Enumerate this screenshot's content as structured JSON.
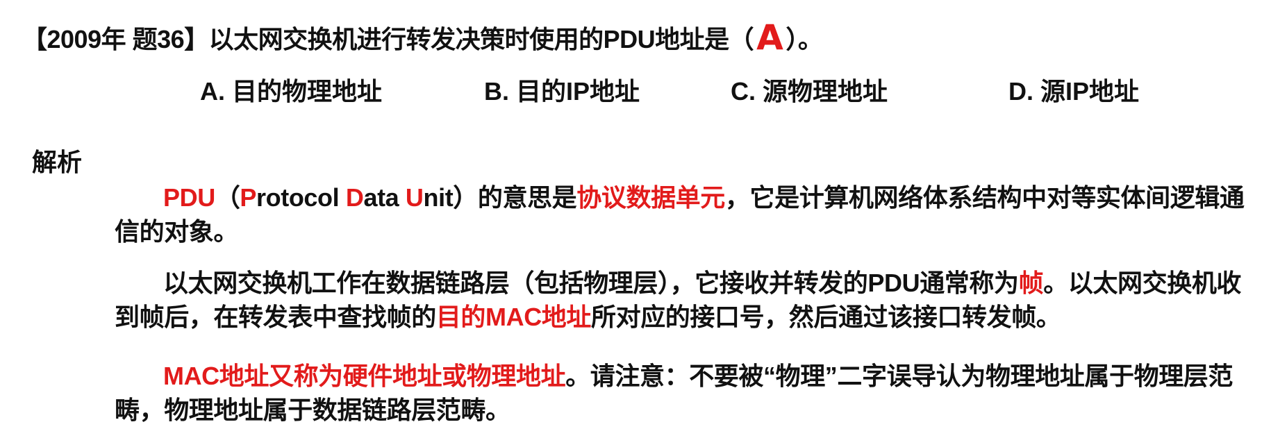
{
  "question": {
    "prefix": "【2009年 题36】以太网交换机进行转发决策时使用的PDU地址是（",
    "answer": "A",
    "suffix": "）。"
  },
  "options": [
    {
      "label": "A. 目的物理地址"
    },
    {
      "label": "B. 目的IP地址"
    },
    {
      "label": "C. 源物理地址"
    },
    {
      "label": "D. 源IP地址"
    }
  ],
  "analysis": {
    "title": "解析",
    "p1": {
      "t1": "PDU",
      "t2": "（",
      "t3": "P",
      "t4": "rotocol ",
      "t5": "D",
      "t6": "ata ",
      "t7": "U",
      "t8": "nit）的意思是",
      "t9": "协议数据单元",
      "t10": "，它是计算机网络体系结构中对等实体间逻辑通信的对象。"
    },
    "p2": {
      "t1": "以太网交换机工作在数据链路层（包括物理层），它接收并转发的PDU通常称为",
      "t2": "帧",
      "t3": "。以太网交换机收到帧后，在转发表中查找帧的",
      "t4": "目的MAC地址",
      "t5": "所对应的接口号，然后通过该接口转发帧。"
    },
    "p3": {
      "t1": "MAC地址又称为硬件地址或物理地址",
      "t2": "。请注意：不要被“物理”二字误导认为物理地址属于物理层范畴，物理地址属于数据链路层范畴。"
    }
  },
  "colors": {
    "highlight": "#e21b1b",
    "text": "#111111",
    "background": "#ffffff"
  }
}
